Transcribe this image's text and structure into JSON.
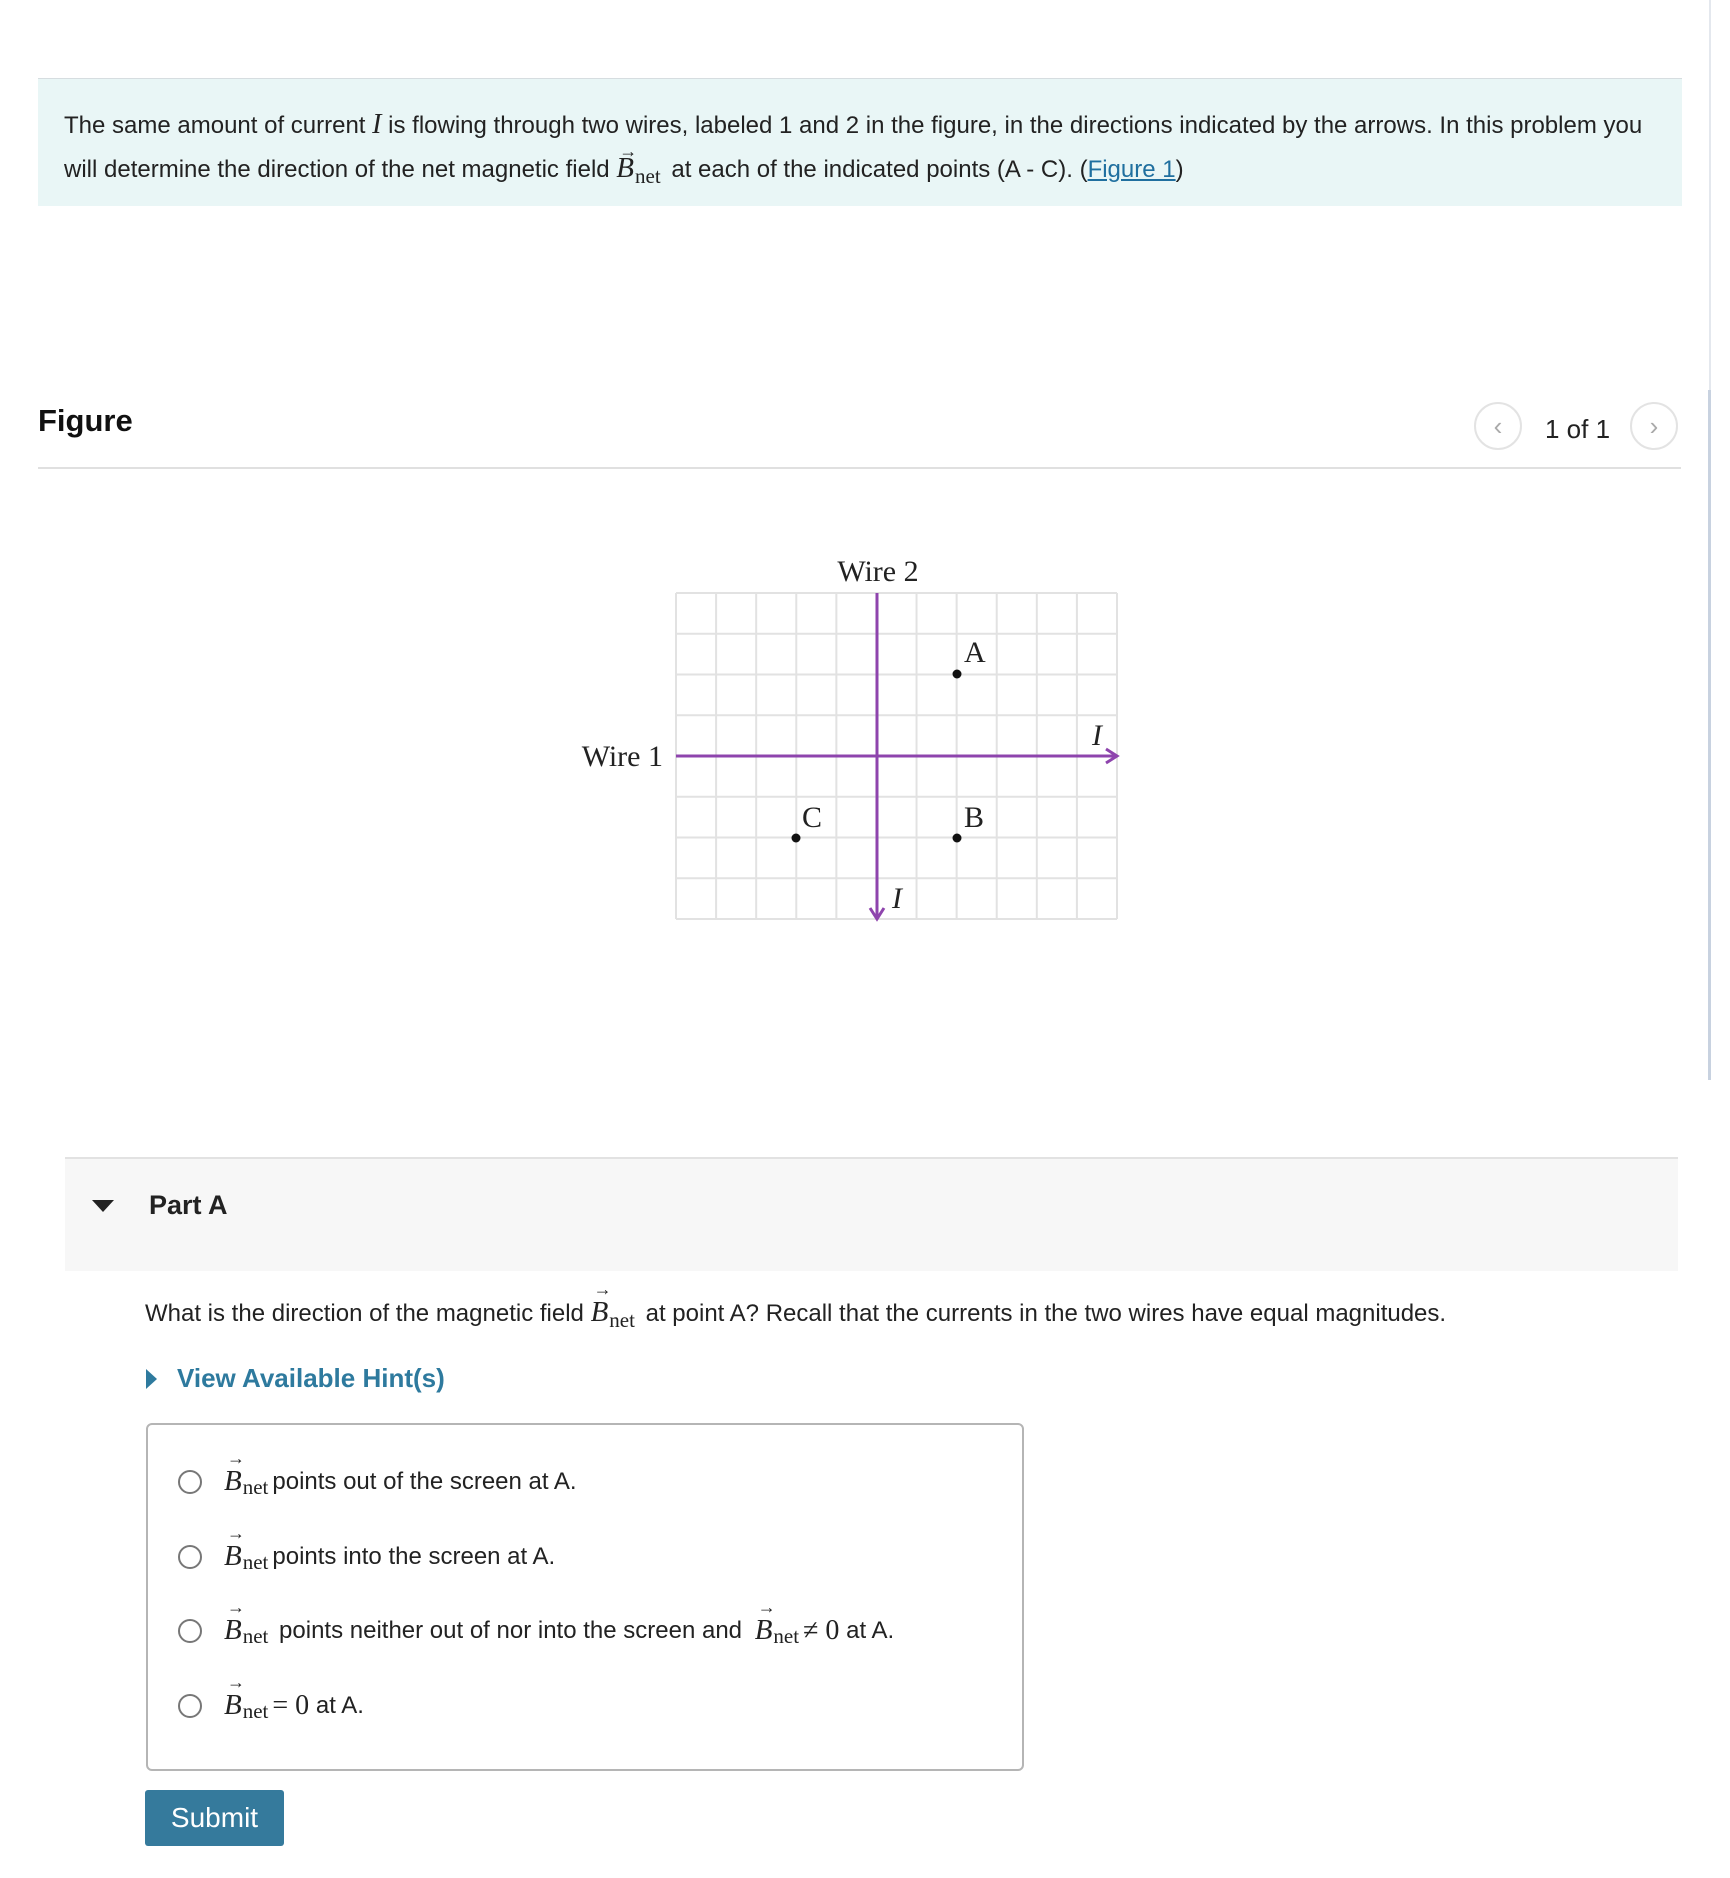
{
  "intro": {
    "t1": "The same amount of current ",
    "current_symbol": "I",
    "t2": " is flowing through two wires, labeled 1 and 2 in the figure, in the directions indicated by the arrows. In this problem you will determine the direction of the net magnetic field ",
    "field_symbol": "B",
    "field_sub": "net",
    "t3": " at each of the indicated points (A - C). (",
    "figure_link": "Figure 1",
    "t4": ")"
  },
  "figure": {
    "title": "Figure",
    "pager": "1 of 1",
    "prev_icon": "chevron-left-icon",
    "next_icon": "chevron-right-icon",
    "wire1_label": "Wire 1",
    "wire2_label": "Wire 2",
    "current_label": "I",
    "points": [
      "A",
      "B",
      "C"
    ],
    "wire_color": "#8e44ad"
  },
  "partA": {
    "label": "Part A",
    "q1": "What is the direction of the magnetic field ",
    "q2": " at point A? Recall that the currents in the two wires have equal magnitudes.",
    "hint_label": "View Available Hint(s)",
    "options": [
      {
        "text": " points out of the screen at A."
      },
      {
        "text": " points into the screen at A."
      },
      {
        "text": " points neither out of nor into the screen and ",
        "rel": "≠ 0",
        "tail": " at A."
      },
      {
        "rel": "= 0",
        "tail": " at A."
      }
    ],
    "submit_label": "Submit"
  },
  "colors": {
    "accent": "#357a9c",
    "link": "#2e7a9e",
    "intro_bg": "#e9f6f6"
  }
}
